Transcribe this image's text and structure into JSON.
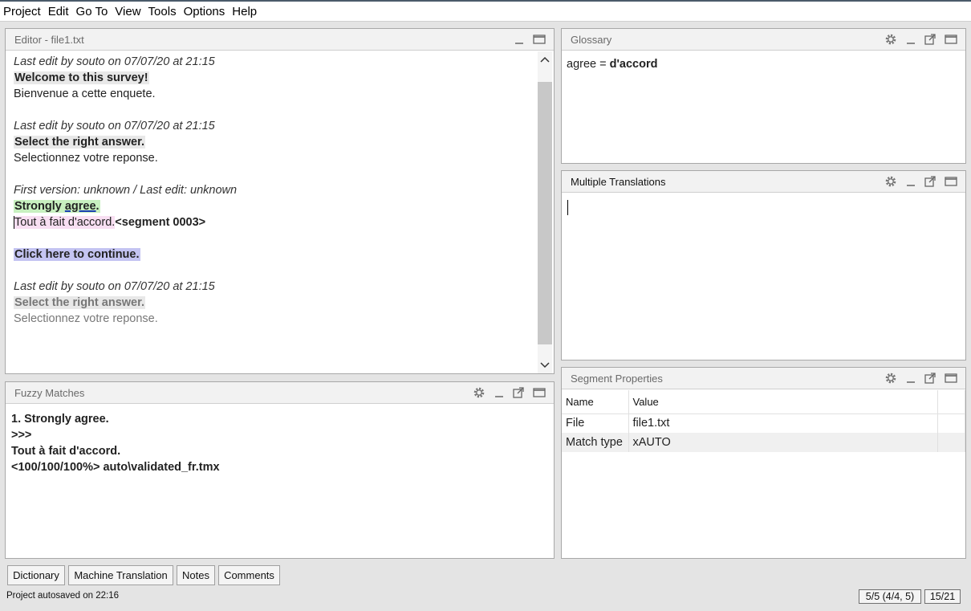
{
  "menu": [
    "Project",
    "Edit",
    "Go To",
    "View",
    "Tools",
    "Options",
    "Help"
  ],
  "editor": {
    "title": "Editor - file1.txt",
    "seg1": {
      "meta": "Last edit by souto on 07/07/20 at 21:15",
      "source": "Welcome to this survey!",
      "target": "Bienvenue a cette enquete."
    },
    "seg2": {
      "meta": "Last edit by souto on 07/07/20 at 21:15",
      "source": "Select the right answer.",
      "target": "Selectionnez votre reponse."
    },
    "seg3": {
      "meta": "First version: unknown / Last edit: unknown",
      "source_a": "Strongly ",
      "source_b": "agree",
      "source_c": ".",
      "target": "Tout à fait d'accord.",
      "tag": "<segment 0003>"
    },
    "seg4": {
      "source": "Click here to continue."
    },
    "seg5": {
      "meta": "Last edit by souto on 07/07/20 at 21:15",
      "source": "Select the right answer.",
      "target": "Selectionnez votre reponse."
    }
  },
  "glossary": {
    "title": "Glossary",
    "term": "agree",
    "equals": " = ",
    "translation": "d'accord"
  },
  "multiple_translations": {
    "title": "Multiple Translations"
  },
  "fuzzy": {
    "title": "Fuzzy Matches",
    "lines": [
      "1. Strongly agree.",
      ">>>",
      "Tout à fait d'accord.",
      "<100/100/100%> auto\\validated_fr.tmx"
    ]
  },
  "segment_properties": {
    "title": "Segment Properties",
    "columns": [
      "Name",
      "Value"
    ],
    "rows": [
      {
        "name": "File",
        "value": "file1.txt"
      },
      {
        "name": "Match type",
        "value": "xAUTO"
      }
    ]
  },
  "tabs": [
    "Dictionary",
    "Machine Translation",
    "Notes",
    "Comments"
  ],
  "status": {
    "message": "Project autosaved on 22:16",
    "progress": "5/5 (4/4, 5)",
    "count": "15/21"
  },
  "icons": {
    "settings": "gear-icon",
    "minimize": "minimize-icon",
    "undock": "undock-icon",
    "maximize": "maximize-icon"
  }
}
